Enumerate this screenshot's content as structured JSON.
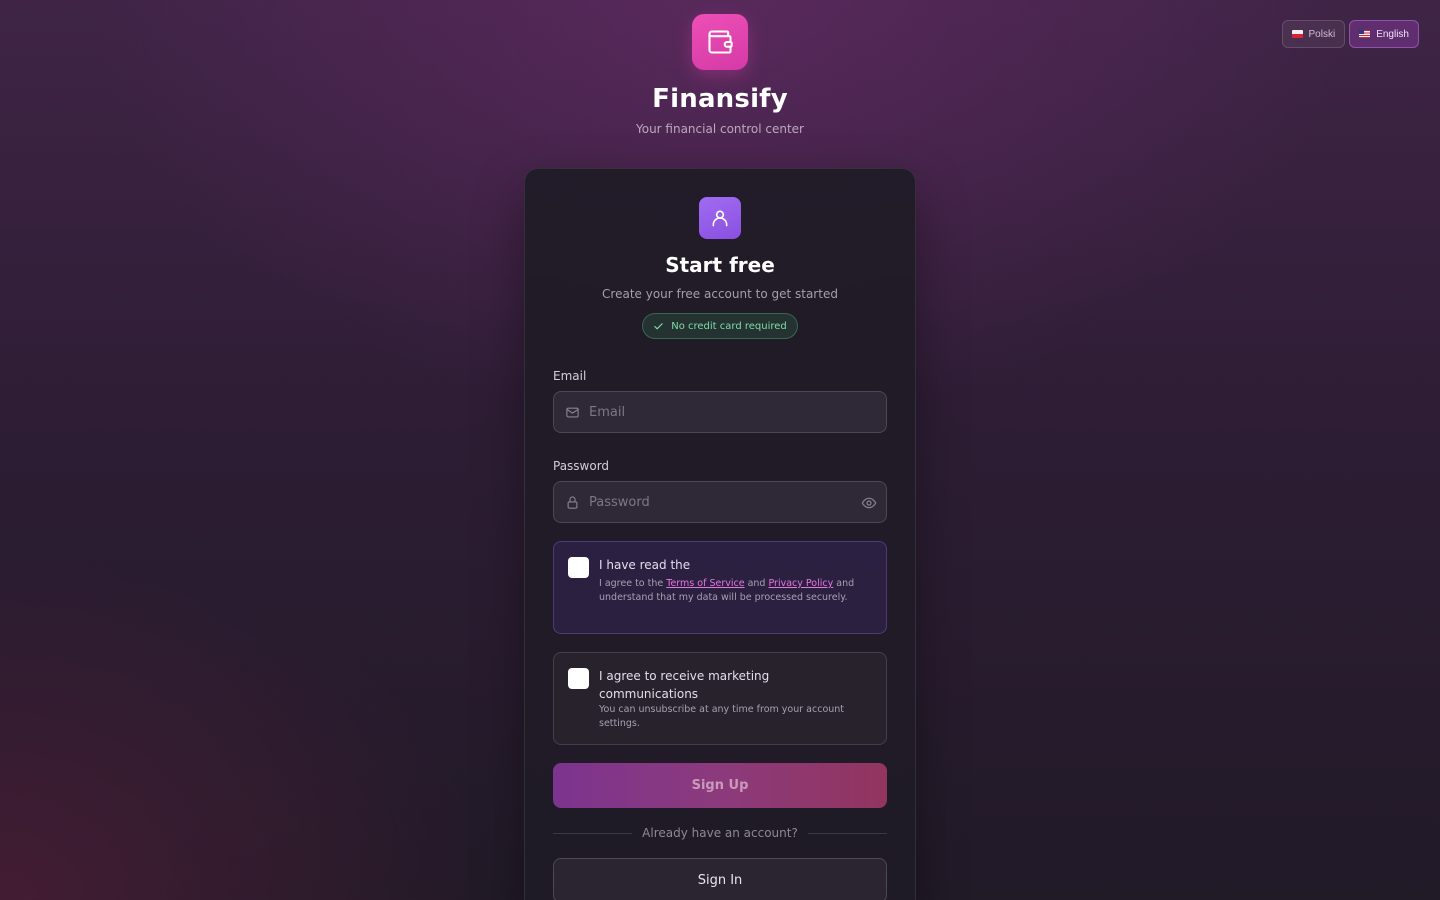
{
  "language": {
    "options": [
      {
        "label": "Polski",
        "active": false
      },
      {
        "label": "English",
        "active": true
      }
    ]
  },
  "brand": {
    "name": "Finansify",
    "tagline": "Your financial control center",
    "logo_icon": "wallet-icon",
    "logo_color": "#e548b0"
  },
  "card": {
    "icon": "user-icon",
    "title": "Start free",
    "subtitle": "Create your free account to get started",
    "badge": "No credit card required"
  },
  "form": {
    "email": {
      "label": "Email",
      "placeholder": "Email",
      "value": ""
    },
    "password": {
      "label": "Password",
      "placeholder": "Password",
      "value": ""
    },
    "terms": {
      "title": "I have read the",
      "desc_prefix": "I agree to the",
      "terms_link": "Terms of Service",
      "and": "and",
      "privacy_link": "Privacy Policy",
      "desc_suffix": "and understand that my data will be processed securely.",
      "checked": false
    },
    "marketing": {
      "title": "I agree to receive marketing communications",
      "desc": "You can unsubscribe at any time from your account settings.",
      "checked": false
    },
    "signup_label": "Sign Up",
    "divider_text": "Already have an account?",
    "signin_label": "Sign In"
  },
  "colors": {
    "accent": "#e548b0",
    "card_icon": "#9a62ec",
    "success": "#7fdca6"
  }
}
